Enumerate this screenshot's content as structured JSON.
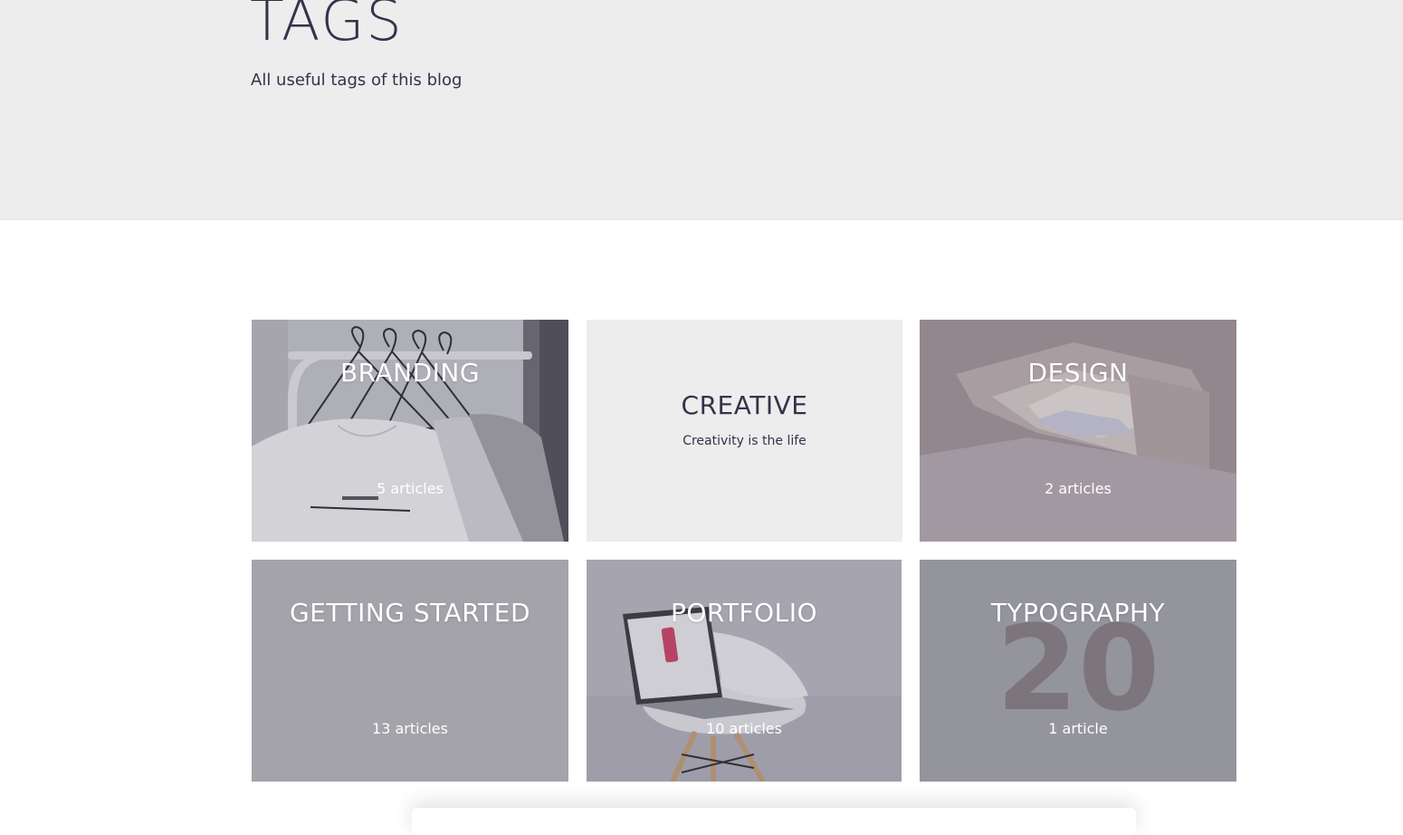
{
  "header": {
    "title": "TAGS",
    "subtitle": "All useful tags of this blog"
  },
  "tags": [
    {
      "name": "BRANDING",
      "count": "5 articles",
      "image": "clothes-rack-with-hangers"
    },
    {
      "name": "CREATIVE",
      "description": "Creativity is the life"
    },
    {
      "name": "DESIGN",
      "count": "2 articles",
      "image": "abstract-architecture-skylight"
    },
    {
      "name": "GETTING STARTED",
      "count": "13 articles"
    },
    {
      "name": "PORTFOLIO",
      "count": "10 articles",
      "image": "laptop-on-white-chair"
    },
    {
      "name": "TYPOGRAPHY",
      "count": "1 article",
      "image": "large-number-20"
    }
  ],
  "colors": {
    "hero_bg": "#ededee",
    "text_dark": "#33334a",
    "card_plain_bg": "#ededee",
    "card_gray_bg": "#a4a3aa"
  }
}
